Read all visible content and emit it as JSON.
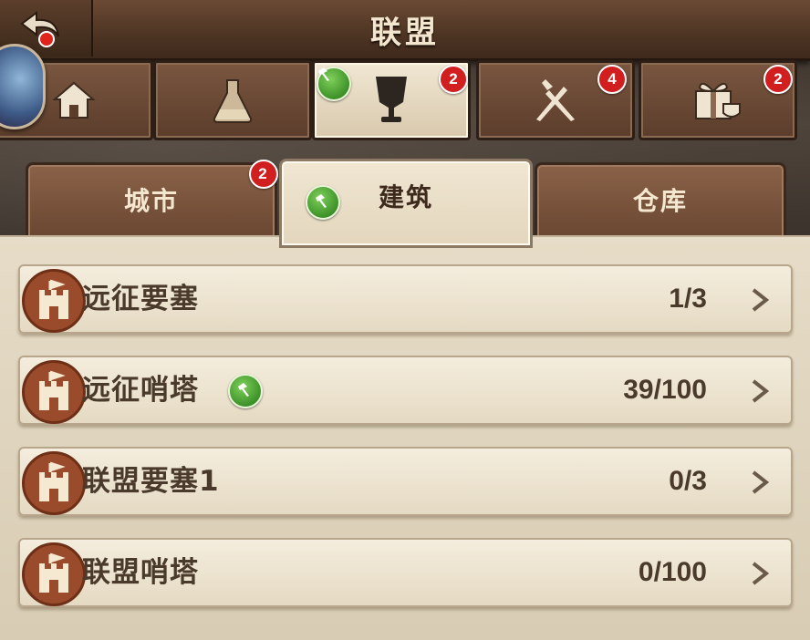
{
  "header": {
    "title": "联盟"
  },
  "category_tabs": [
    {
      "icon": "home-icon",
      "badge": null,
      "active": false
    },
    {
      "icon": "flask-icon",
      "badge": null,
      "active": false
    },
    {
      "icon": "trophy-banner-icon",
      "badge": "2",
      "active": true,
      "has_hammer": true
    },
    {
      "icon": "crossed-weapons-icon",
      "badge": "4",
      "active": false
    },
    {
      "icon": "gift-icon",
      "badge": "2",
      "active": false
    }
  ],
  "sub_tabs": [
    {
      "label": "城市",
      "badge": "2",
      "active": false
    },
    {
      "label": "建筑",
      "active": true,
      "has_hammer": true
    },
    {
      "label": "仓库",
      "active": false
    }
  ],
  "buildings": [
    {
      "name": "远征要塞",
      "count": "1/3",
      "has_hammer": false
    },
    {
      "name": "远征哨塔",
      "count": "39/100",
      "has_hammer": true
    },
    {
      "name": "联盟要塞1",
      "count": "0/3",
      "has_hammer": false
    },
    {
      "name": "联盟哨塔",
      "count": "0/100",
      "has_hammer": false
    }
  ],
  "colors": {
    "badge": "#d11f1f",
    "hammer_badge": "#3d9229",
    "wood": "#6b4a34",
    "parchment": "#e6dcc7"
  }
}
